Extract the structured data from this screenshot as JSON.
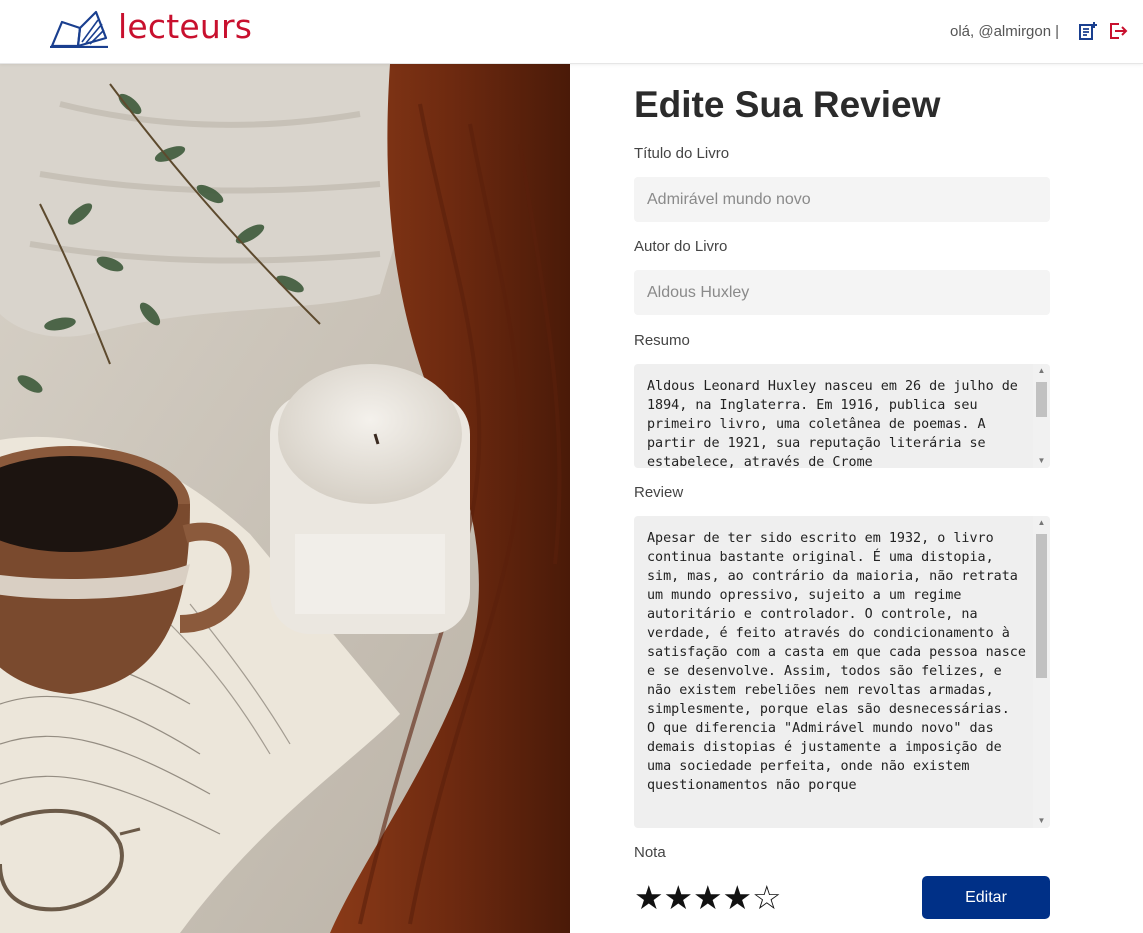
{
  "header": {
    "logo_text": "lecteurs",
    "greeting": "olá, @almirgon",
    "separator": "|",
    "icons": [
      "book-logo-icon",
      "new-review-icon",
      "logout-icon"
    ]
  },
  "colors": {
    "brand_red": "#c8102e",
    "brand_blue": "#1a3f8f",
    "button_blue": "#003087"
  },
  "form": {
    "title": "Edite Sua Review",
    "book_title_label": "Título do Livro",
    "book_title_placeholder": "Admirável mundo novo",
    "author_label": "Autor do Livro",
    "author_placeholder": "Aldous Huxley",
    "summary_label": "Resumo",
    "summary_text": "Aldous Leonard Huxley nasceu em 26 de julho de 1894, na Inglaterra. Em 1916, publica seu primeiro livro, uma coletânea de poemas. A partir de 1921, sua reputação literária se estabelece, através de Crome",
    "review_label": "Review",
    "review_text": "Apesar de ter sido escrito em 1932, o livro continua bastante original. É uma distopia, sim, mas, ao contrário da maioria, não retrata um mundo opressivo, sujeito a um regime autoritário e controlador. O controle, na verdade, é feito através do condicionamento à satisfação com a casta em que cada pessoa nasce e se desenvolve. Assim, todos são felizes, e não existem rebeliões nem revoltas armadas, simplesmente, porque elas são desnecessárias.\nO que diferencia \"Admirável mundo novo\" das demais distopias é justamente a imposição de uma sociedade perfeita, onde não existem questionamentos não porque",
    "rating_label": "Nota",
    "rating": 4,
    "rating_max": 5,
    "star_full": "★",
    "star_empty": "☆",
    "submit_label": "Editar"
  }
}
